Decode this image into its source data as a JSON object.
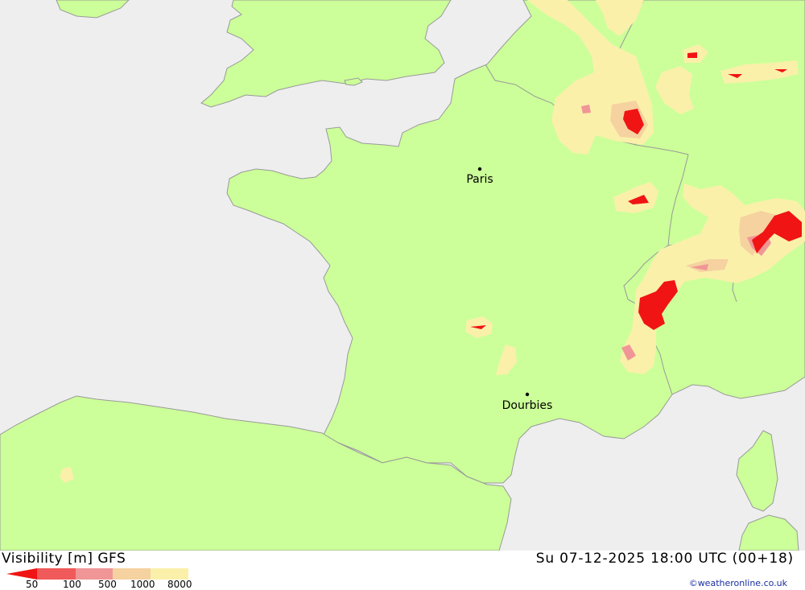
{
  "product": {
    "title": "Visibility [m] GFS",
    "valid_time": "Su 07-12-2025 18:00 UTC (00+18)",
    "copyright": "©weatheronline.co.uk"
  },
  "legend": {
    "ticks": [
      "50",
      "100",
      "500",
      "1000",
      "8000"
    ],
    "colors": [
      "#f01414",
      "#f05a5a",
      "#f09696",
      "#f5d2a0",
      "#faf0aa"
    ]
  },
  "cities": [
    {
      "name": "Paris"
    },
    {
      "name": "Dourbies"
    }
  ],
  "colors": {
    "land": "#ccff99",
    "sea": "#eeeeee",
    "border": "#999999"
  }
}
